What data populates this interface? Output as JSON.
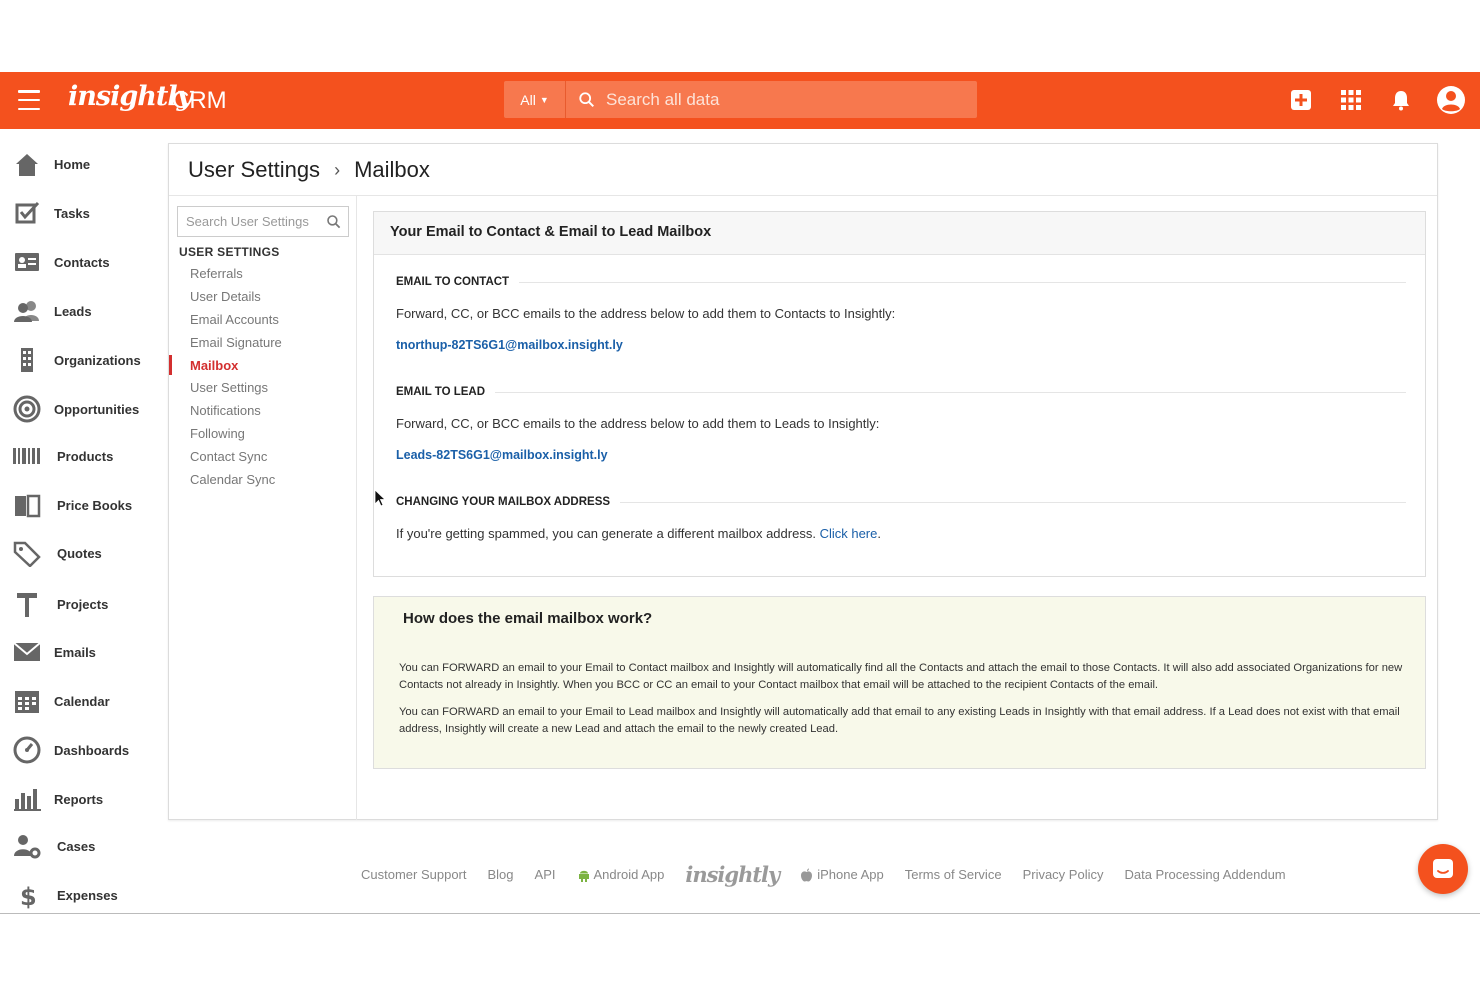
{
  "header": {
    "logo": "insightly",
    "product": "CRM",
    "search_scope": "All",
    "search_placeholder": "Search all data"
  },
  "sidebar": {
    "items": [
      {
        "label": "Home",
        "icon": "home-icon"
      },
      {
        "label": "Tasks",
        "icon": "tasks-icon"
      },
      {
        "label": "Contacts",
        "icon": "contacts-icon"
      },
      {
        "label": "Leads",
        "icon": "leads-icon"
      },
      {
        "label": "Organizations",
        "icon": "organizations-icon"
      },
      {
        "label": "Opportunities",
        "icon": "opportunities-icon"
      },
      {
        "label": "Products",
        "icon": "products-icon"
      },
      {
        "label": "Price Books",
        "icon": "price-books-icon"
      },
      {
        "label": "Quotes",
        "icon": "quotes-icon"
      },
      {
        "label": "Projects",
        "icon": "projects-icon"
      },
      {
        "label": "Emails",
        "icon": "emails-icon"
      },
      {
        "label": "Calendar",
        "icon": "calendar-icon"
      },
      {
        "label": "Dashboards",
        "icon": "dashboards-icon"
      },
      {
        "label": "Reports",
        "icon": "reports-icon"
      },
      {
        "label": "Cases",
        "icon": "cases-icon"
      },
      {
        "label": "Expenses",
        "icon": "expenses-icon"
      }
    ]
  },
  "breadcrumb": {
    "parent": "User Settings",
    "separator": "›",
    "current": "Mailbox"
  },
  "settings_nav": {
    "search_placeholder": "Search User Settings",
    "heading": "USER SETTINGS",
    "links": [
      "Referrals",
      "User Details",
      "Email Accounts",
      "Email Signature",
      "Mailbox",
      "User Settings",
      "Notifications",
      "Following",
      "Contact Sync",
      "Calendar Sync"
    ],
    "active": "Mailbox"
  },
  "mailbox": {
    "title": "Your Email to Contact & Email to Lead Mailbox",
    "contact": {
      "heading": "EMAIL TO CONTACT",
      "text": "Forward, CC, or BCC emails to the address below to add them to Contacts to Insightly:",
      "address": "tnorthup-82TS6G1@mailbox.insight.ly"
    },
    "lead": {
      "heading": "EMAIL TO LEAD",
      "text": "Forward, CC, or BCC emails to the address below to add them to Leads to Insightly:",
      "address": "Leads-82TS6G1@mailbox.insight.ly"
    },
    "change": {
      "heading": "CHANGING YOUR MAILBOX ADDRESS",
      "text": "If you're getting spammed, you can generate a different mailbox address.",
      "link": "Click here",
      "suffix": "."
    }
  },
  "howto": {
    "title": "How does the email mailbox work?",
    "p1": "You can FORWARD an email to your Email to Contact mailbox and Insightly will automatically find all the Contacts and attach the email to those Contacts. It will also add associated Organizations for new Contacts not already in Insightly. When you BCC or CC an email to your Contact mailbox that email will be attached to the recipient Contacts of the email.",
    "p2": "You can FORWARD an email to your Email to Lead mailbox and Insightly will automatically add that email to any existing Leads in Insightly with that email address. If a Lead does not exist with that email address, Insightly will create a new Lead and attach the email to the newly created Lead."
  },
  "footer": {
    "support": "Customer Support",
    "blog": "Blog",
    "api": "API",
    "android": "Android App",
    "logo": "insightly",
    "iphone": "iPhone App",
    "terms": "Terms of Service",
    "privacy": "Privacy Policy",
    "dpa": "Data Processing Addendum"
  },
  "colors": {
    "brand": "#f4511e",
    "active": "#d32f2f",
    "link": "#1a5fa8",
    "info_bg": "#f8f9ea"
  }
}
